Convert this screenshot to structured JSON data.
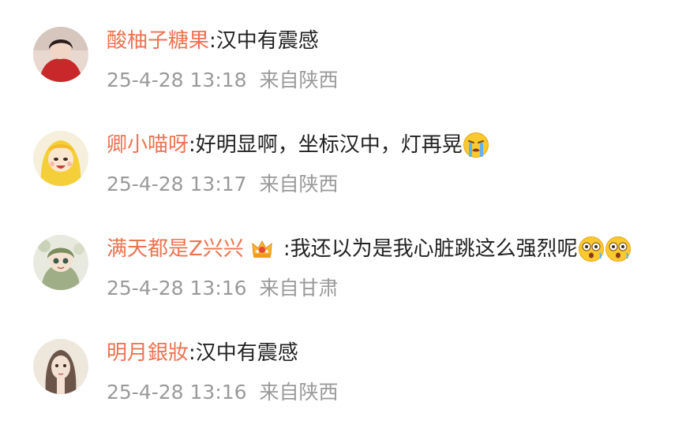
{
  "comments": [
    {
      "username": "酸柚子糖果",
      "separator": ":",
      "text": "汉中有震感",
      "time": "25-4-28 13:18",
      "location": "来自陕西",
      "avatar": "girl-red-sweater-avatar"
    },
    {
      "username": "卿小喵呀",
      "separator": ":",
      "text": "好明显啊，坐标汉中，灯再晃",
      "time": "25-4-28 13:17",
      "location": "来自陕西",
      "emoji": "crying-face-emoji",
      "avatar": "cartoon-girl-yellow-avatar"
    },
    {
      "username": "满天都是Z兴兴",
      "separator": ":",
      "text": "我还以为是我心脏跳这么强烈呢",
      "time": "25-4-28 13:16",
      "location": "来自甘肃",
      "badge": "crown-badge",
      "emoji": "shocked-face-emoji",
      "avatar": "anime-girl-green-avatar"
    },
    {
      "username": "明月銀妝",
      "separator": ":",
      "text": "汉中有震感",
      "time": "25-4-28 13:16",
      "location": "来自陕西",
      "avatar": "illustrated-girl-beige-avatar"
    }
  ],
  "colors": {
    "username": "#eb7350",
    "text": "#222222",
    "meta": "#9a9a9a"
  }
}
